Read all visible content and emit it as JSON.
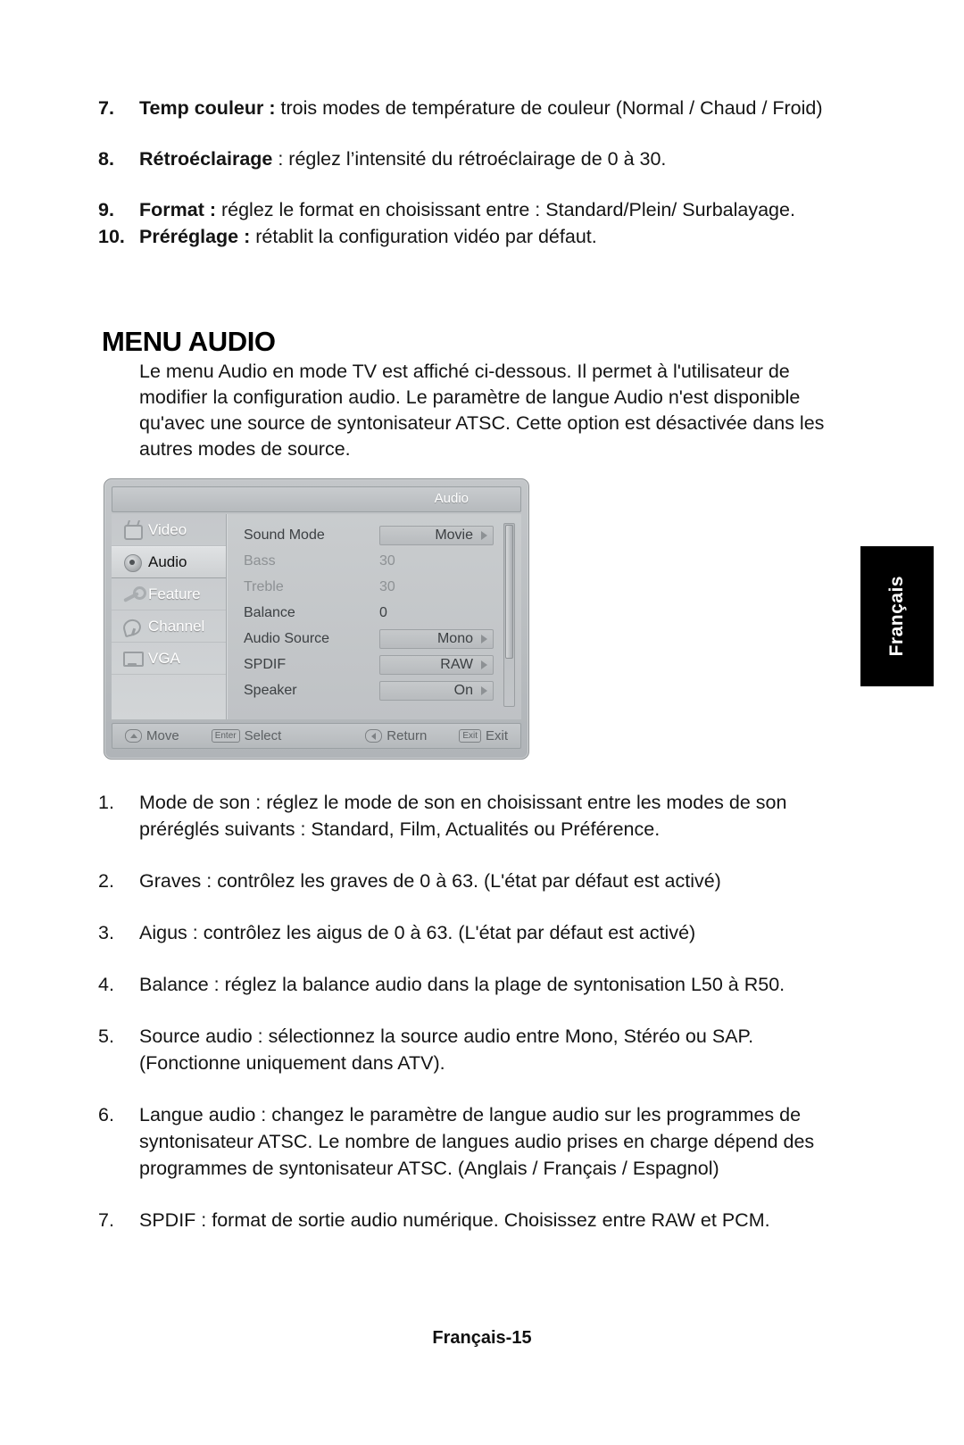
{
  "top_list": [
    {
      "num": "7.",
      "lead": "Temp couleur :",
      "text": " trois modes de température de couleur (Normal / Chaud / Froid)"
    },
    {
      "num": "8.",
      "lead": "Rétroéclairage",
      "text": " : réglez l’intensité du rétroéclairage de 0 à 30."
    },
    {
      "num": "9.",
      "lead": "Format :",
      "text": " réglez le format en choisissant entre : Standard/Plein/ Surbalayage."
    },
    {
      "num": "10.",
      "lead": "Préréglage :",
      "text": " rétablit la configuration vidéo par défaut."
    }
  ],
  "section": {
    "heading": "MENU AUDIO",
    "intro": "Le menu Audio en mode TV est affiché ci-dessous. Il permet à l'utilisateur de modifier la configuration audio. Le paramètre de langue Audio n'est disponible qu'avec une source de syntonisateur ATSC. Cette option est désactivée dans les autres modes de source."
  },
  "osd": {
    "title": "Audio",
    "nav": [
      {
        "label": "Video",
        "icon": "tv-icon",
        "selected": false
      },
      {
        "label": "Audio",
        "icon": "speaker-icon",
        "selected": true
      },
      {
        "label": "Feature",
        "icon": "wrench-icon",
        "selected": false
      },
      {
        "label": "Channel",
        "icon": "satellite-dish-icon",
        "selected": false
      },
      {
        "label": "VGA",
        "icon": "monitor-icon",
        "selected": false
      }
    ],
    "settings": [
      {
        "label": "Sound Mode",
        "value": "Movie",
        "type": "box",
        "dim": false
      },
      {
        "label": "Bass",
        "value": "30",
        "type": "plain",
        "dim": true
      },
      {
        "label": "Treble",
        "value": "30",
        "type": "plain",
        "dim": true
      },
      {
        "label": "Balance",
        "value": "0",
        "type": "plain",
        "dim": false
      },
      {
        "label": "Audio Source",
        "value": "Mono",
        "type": "box",
        "dim": false
      },
      {
        "label": "SPDIF",
        "value": "RAW",
        "type": "box",
        "dim": false
      },
      {
        "label": "Speaker",
        "value": "On",
        "type": "box",
        "dim": false
      }
    ],
    "footer": {
      "move": "Move",
      "select_key": "Enter",
      "select": "Select",
      "return": "Return",
      "exit_key": "Exit",
      "exit": "Exit"
    }
  },
  "language_tab": "Français",
  "bottom_list": [
    {
      "num": "1.",
      "text": "Mode de son : réglez le mode de son en choisissant entre les modes de son préréglés suivants : Standard, Film, Actualités ou Préférence."
    },
    {
      "num": "2.",
      "text": "Graves : contrôlez les graves de 0 à 63. (L'état par défaut est activé)"
    },
    {
      "num": "3.",
      "text": "Aigus : contrôlez les aigus de 0 à 63. (L'état par défaut est activé)"
    },
    {
      "num": "4.",
      "text": "Balance : réglez la balance audio dans la plage de syntonisation L50 à R50."
    },
    {
      "num": "5.",
      "text": "Source audio : sélectionnez la source audio entre Mono, Stéréo ou SAP. (Fonctionne uniquement dans ATV)."
    },
    {
      "num": "6.",
      "text": "Langue audio : changez le paramètre de langue audio sur les programmes de syntonisateur ATSC. Le nombre de langues audio prises en charge dépend des programmes de syntonisateur ATSC. (Anglais / Français / Espagnol)"
    },
    {
      "num": "7.",
      "text": "SPDIF : format de sortie audio numérique. Choisissez entre RAW et PCM."
    }
  ],
  "page_footer": "Français-15"
}
